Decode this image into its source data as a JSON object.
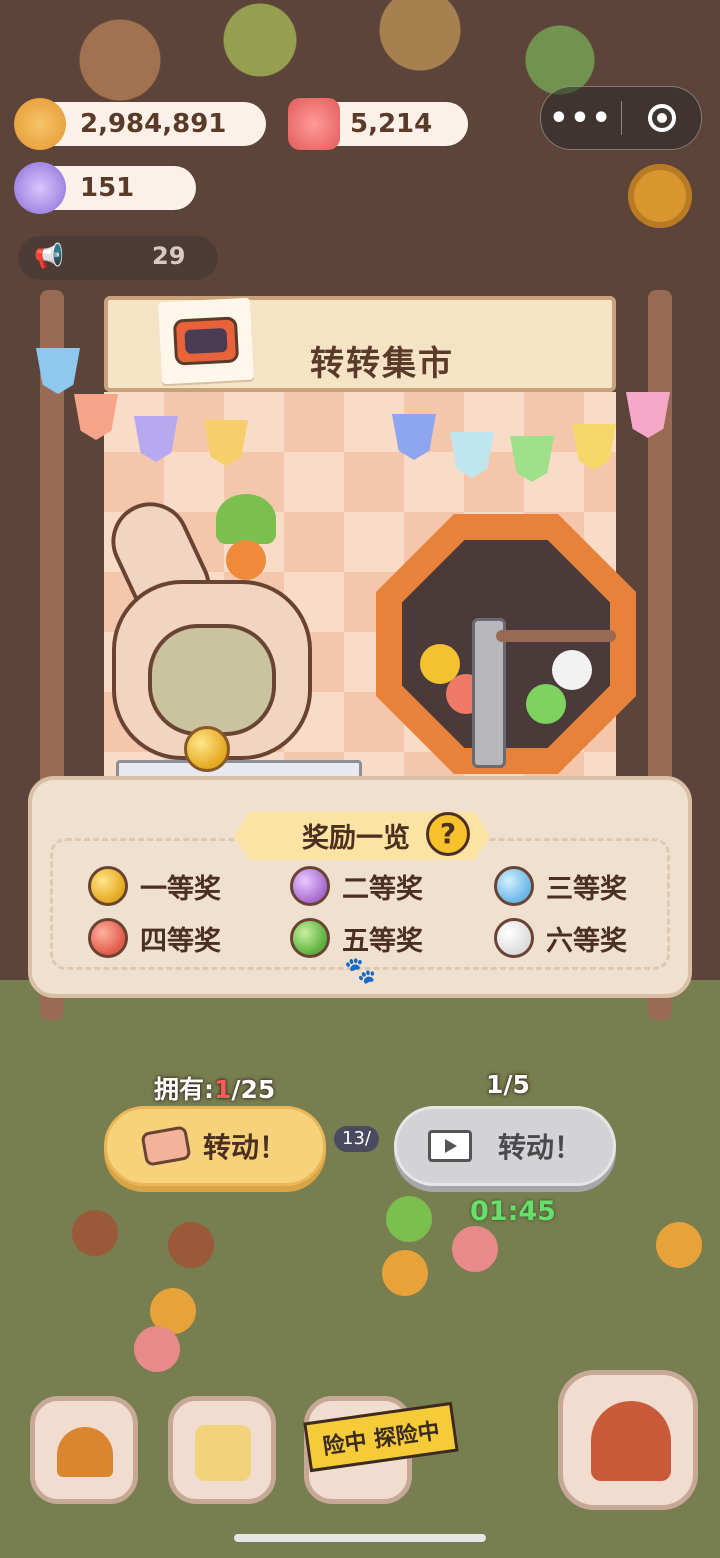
{
  "currencies": {
    "cookie": "2,984,891",
    "candle": "5,214",
    "candy": "151"
  },
  "notice_count": "29",
  "menu_capsule": {
    "more": "•••"
  },
  "stall": {
    "title": "转转集市"
  },
  "rewards": {
    "title": "奖励一览",
    "help": "?",
    "prizes": [
      {
        "label": "一等奖",
        "color": "#f2c230"
      },
      {
        "label": "二等奖",
        "color": "#c58be0"
      },
      {
        "label": "三等奖",
        "color": "#8fd0f2"
      },
      {
        "label": "四等奖",
        "color": "#ef7a68"
      },
      {
        "label": "五等奖",
        "color": "#7fd160"
      },
      {
        "label": "六等奖",
        "color": "#f2f2f2"
      }
    ]
  },
  "spin": {
    "owned_prefix": "拥有:",
    "owned_value": "1",
    "owned_suffix": "/25",
    "ad_count": "1/5",
    "button1_label": "转动！",
    "button2_label": "转动！",
    "timer": "01:45",
    "badge": "13/"
  },
  "bottom_nav": {
    "adventure_ribbon": "险中 探险中"
  }
}
